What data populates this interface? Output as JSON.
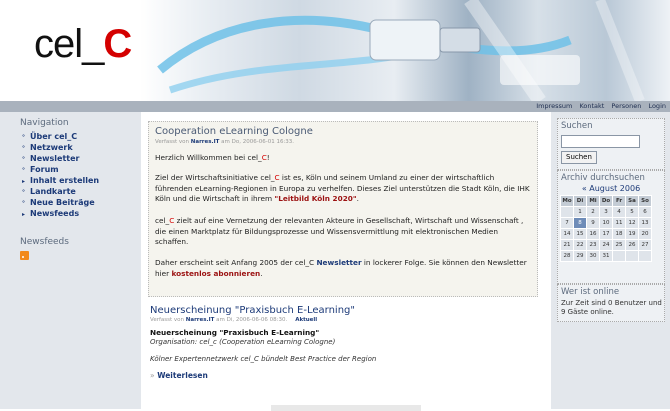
{
  "logo": {
    "prefix": "cel_",
    "suffix": "C"
  },
  "top_links": [
    "Impressum",
    "Kontakt",
    "Personen",
    "Login"
  ],
  "sidebar": {
    "nav_title": "Navigation",
    "items": [
      {
        "label": "Über cel_C",
        "bullet": "°"
      },
      {
        "label": "Netzwerk",
        "bullet": "°"
      },
      {
        "label": "Newsletter",
        "bullet": "°"
      },
      {
        "label": "Forum",
        "bullet": "°"
      },
      {
        "label": "Inhalt erstellen",
        "bullet": "▸"
      },
      {
        "label": "Landkarte",
        "bullet": "°"
      },
      {
        "label": "Neue Beiträge",
        "bullet": "°"
      },
      {
        "label": "Newsfeeds",
        "bullet": "▸"
      }
    ],
    "feeds_title": "Newsfeeds",
    "rss_icon": "rss-icon"
  },
  "welcome": {
    "title": "Cooperation eLearning Cologne",
    "meta_prefix": "Verfasst von",
    "meta_author": "Narres.IT",
    "meta_suffix": "am Do, 2006-06-01 16:33.",
    "p1_a": "Herzlich Willkommen bei cel_",
    "p1_c": "C",
    "p1_b": "!",
    "p2_a": "Ziel der Wirtschaftsinitiative cel_",
    "p2_c": "C",
    "p2_b": " ist es, Köln und seinem Umland zu einer der wirtschaftlich führenden eLearning-Regionen in Europa zu verhelfen. Dieses Ziel unterstützen die Stadt Köln, die IHK Köln und die Wirtschaft in ihrem ",
    "p2_link": "\"Leitbild Köln 2020\"",
    "p2_end": ".",
    "p3_a": "cel_",
    "p3_c": "C",
    "p3_b": " zielt auf eine Vernetzung der relevanten Akteure in Gesellschaft, Wirtschaft und Wissenschaft , die einen Marktplatz für Bildungsprozesse und Wissensvermittlung mit elektronischen Medien schaffen.",
    "p4_a": "Daher erscheint seit Anfang 2005 der cel_C ",
    "p4_link1": "Newsletter",
    "p4_b": " in lockerer Folge. Sie können den Newsletter hier ",
    "p4_link2": "kostenlos abonnieren",
    "p4_end": "."
  },
  "article": {
    "title": "Neuerscheinung \"Praxisbuch E-Learning\"",
    "meta_prefix": "Verfasst von",
    "meta_author": "Narres.IT",
    "meta_suffix": "am Di, 2006-06-06 08:30.",
    "tag": "Aktuell",
    "headline": "Neuerscheinung \"Praxisbuch E-Learning\"",
    "org": "Organisation: cel_c (Cooperation eLearning Cologne)",
    "teaser": "Kölner Expertennetzwerk cel_C bündelt Best Practice der Region",
    "more_arrow": "»",
    "more": "Weiterlesen"
  },
  "search": {
    "title": "Suchen",
    "button": "Suchen",
    "value": ""
  },
  "archive": {
    "title": "Archiv durchsuchen",
    "prev": "«",
    "month": "August 2006",
    "weekdays": [
      "Mo",
      "Di",
      "Mi",
      "Do",
      "Fr",
      "Sa",
      "So"
    ],
    "weeks": [
      [
        "",
        "1",
        "2",
        "3",
        "4",
        "5",
        "6"
      ],
      [
        "7",
        "8",
        "9",
        "10",
        "11",
        "12",
        "13"
      ],
      [
        "14",
        "15",
        "16",
        "17",
        "18",
        "19",
        "20"
      ],
      [
        "21",
        "22",
        "23",
        "24",
        "25",
        "26",
        "27"
      ],
      [
        "28",
        "29",
        "30",
        "31",
        "",
        "",
        ""
      ]
    ],
    "today": "8"
  },
  "online": {
    "title": "Wer ist online",
    "text": "Zur Zeit sind 0 Benutzer und 9 Gäste online."
  },
  "colors": {
    "brand_red": "#d40000",
    "link_blue": "#1c3a78",
    "sidebar_bg": "#e3e7ec"
  }
}
